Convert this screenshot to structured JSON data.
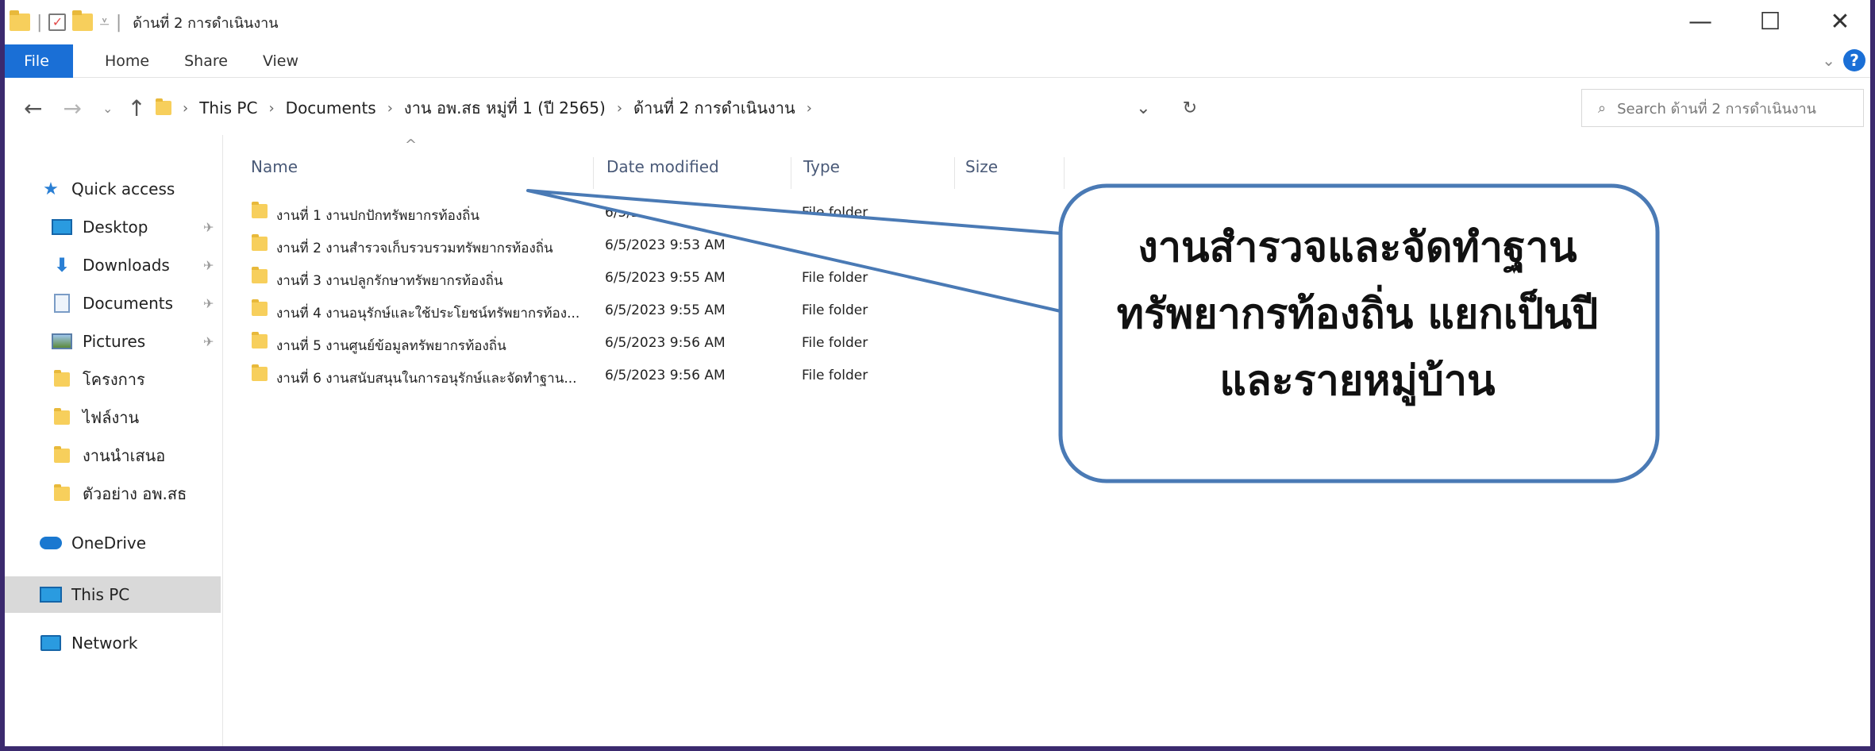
{
  "window": {
    "title": "ด้านที่ 2 การดำเนินงาน",
    "controls": [
      "—",
      "☐",
      "✕"
    ]
  },
  "ribbon": {
    "tabs": [
      "File",
      "Home",
      "Share",
      "View"
    ]
  },
  "address": {
    "crumbs": [
      "This PC",
      "Documents",
      "งาน อพ.สธ หมู่ที่ 1 (ปี 2565)",
      "ด้านที่ 2 การดำเนินงาน"
    ],
    "search_placeholder": "Search ด้านที่ 2 การดำเนินงาน"
  },
  "sidebar": {
    "quick_access": "Quick access",
    "items": [
      {
        "label": "Desktop",
        "icon": "desktop-icon",
        "pinned": true
      },
      {
        "label": "Downloads",
        "icon": "download-icon",
        "pinned": true
      },
      {
        "label": "Documents",
        "icon": "documents-icon",
        "pinned": true
      },
      {
        "label": "Pictures",
        "icon": "pictures-icon",
        "pinned": true
      },
      {
        "label": "โครงการ",
        "icon": "folder-icon",
        "pinned": false
      },
      {
        "label": "ไฟล์งาน",
        "icon": "folder-icon",
        "pinned": false
      },
      {
        "label": "งานนำเสนอ",
        "icon": "folder-icon",
        "pinned": false
      },
      {
        "label": "ตัวอย่าง อพ.สธ",
        "icon": "folder-icon",
        "pinned": false
      }
    ],
    "onedrive": "OneDrive",
    "this_pc": "This PC",
    "network": "Network"
  },
  "columns": {
    "name": "Name",
    "date": "Date modified",
    "type": "Type",
    "size": "Size"
  },
  "files": [
    {
      "name": "งานที่ 1 งานปกปักทรัพยากรท้องถิ่น",
      "date": "6/5/2023 9:53 AM",
      "type": "File folder"
    },
    {
      "name": "งานที่ 2 งานสำรวจเก็บรวบรวมทรัพยากรท้องถิ่น",
      "date": "6/5/2023 9:53 AM",
      "type": ""
    },
    {
      "name": "งานที่ 3 งานปลูกรักษาทรัพยากรท้องถิ่น",
      "date": "6/5/2023 9:55 AM",
      "type": "File folder"
    },
    {
      "name": "งานที่ 4 งานอนุรักษ์และใช้ประโยชน์ทรัพยากรท้อง...",
      "date": "6/5/2023 9:55 AM",
      "type": "File folder"
    },
    {
      "name": "งานที่ 5 งานศูนย์ข้อมูลทรัพยากรท้องถิ่น",
      "date": "6/5/2023 9:56 AM",
      "type": "File folder"
    },
    {
      "name": "งานที่ 6 งานสนับสนุนในการอนุรักษ์และจัดทำฐาน...",
      "date": "6/5/2023 9:56 AM",
      "type": "File folder"
    }
  ],
  "callout": {
    "lines": [
      "งานสำรวจและจัดทำฐาน",
      "ทรัพยากรท้องถิ่น แยกเป็นปี",
      "และรายหมู่บ้าน"
    ],
    "border_color": "#4a7ab5"
  }
}
